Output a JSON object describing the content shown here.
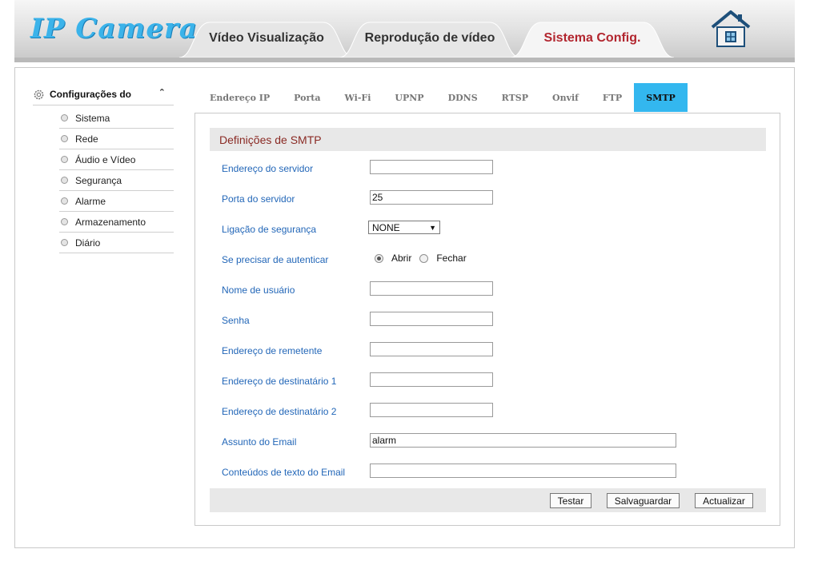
{
  "header": {
    "logo_text": "IP Camera",
    "tabs": [
      {
        "label": "Vídeo Visualização",
        "active": false
      },
      {
        "label": "Reprodução de vídeo",
        "active": false
      },
      {
        "label": "Sistema Config.",
        "active": true
      }
    ],
    "home_icon": "home-icon"
  },
  "sidebar": {
    "title": "Configurações do",
    "items": [
      {
        "label": "Sistema"
      },
      {
        "label": "Rede"
      },
      {
        "label": "Áudio e Vídeo"
      },
      {
        "label": "Segurança"
      },
      {
        "label": "Alarme"
      },
      {
        "label": "Armazenamento"
      },
      {
        "label": "Diário"
      }
    ]
  },
  "subtabs": [
    {
      "label": "Endereço IP"
    },
    {
      "label": "Porta"
    },
    {
      "label": "Wi-Fi"
    },
    {
      "label": "UPNP"
    },
    {
      "label": "DDNS"
    },
    {
      "label": "RTSP"
    },
    {
      "label": "Onvif"
    },
    {
      "label": "FTP"
    },
    {
      "label": "SMTP",
      "active": true
    }
  ],
  "smtp": {
    "title": "Definições de SMTP",
    "server_address": {
      "label": "Endereço do servidor",
      "value": ""
    },
    "server_port": {
      "label": "Porta do servidor",
      "value": "25"
    },
    "secure_connection": {
      "label": "Ligação de segurança",
      "value": "NONE"
    },
    "need_auth": {
      "label": "Se precisar de autenticar",
      "option_on": "Abrir",
      "option_off": "Fechar",
      "selected": "Abrir"
    },
    "username": {
      "label": "Nome de usuário",
      "value": ""
    },
    "password": {
      "label": "Senha",
      "value": ""
    },
    "sender": {
      "label": "Endereço de remetente",
      "value": ""
    },
    "recipient1": {
      "label": "Endereço de destinatário 1",
      "value": ""
    },
    "recipient2": {
      "label": "Endereço de destinatário 2",
      "value": ""
    },
    "subject": {
      "label": "Assunto do Email",
      "value": "alarm"
    },
    "body": {
      "label": "Conteúdos de texto do Email",
      "value": ""
    }
  },
  "buttons": {
    "test": "Testar",
    "save": "Salvaguardar",
    "refresh": "Actualizar"
  },
  "colors": {
    "active_subtab": "#33b7ef",
    "active_main_tab_text": "#b2262f",
    "field_label": "#2367b8",
    "section_title": "#8a2a24",
    "logo": "#3bb3ea"
  }
}
